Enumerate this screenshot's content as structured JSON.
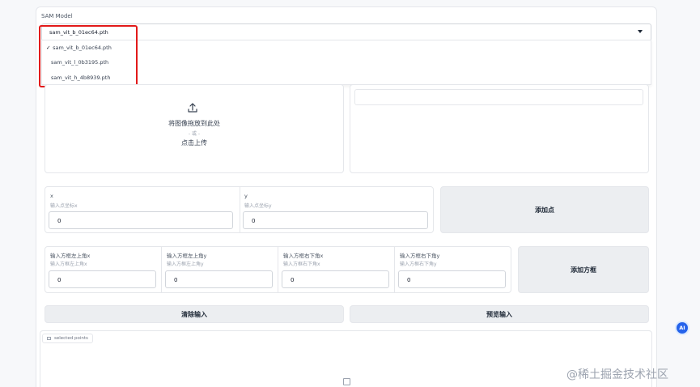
{
  "model": {
    "label": "SAM Model",
    "selected": "sam_vit_b_01ec64.pth",
    "options": [
      {
        "label": "sam_vit_b_01ec64.pth",
        "check": "✓"
      },
      {
        "label": "sam_vit_l_0b3195.pth",
        "check": ""
      },
      {
        "label": "sam_vit_h_4b8939.pth",
        "check": ""
      }
    ]
  },
  "upload": {
    "line1": "将图像拖放到此处",
    "line2": "- 或 -",
    "line3": "点击上传"
  },
  "point": {
    "x_label": "x",
    "x_hint": "输入点坐标x",
    "x_value": "0",
    "y_label": "y",
    "y_hint": "输入点坐标y",
    "y_value": "0",
    "add_button": "添加点"
  },
  "box": {
    "fields": [
      {
        "label": "输入方框左上角x",
        "hint": "输入方框左上角x",
        "value": "0"
      },
      {
        "label": "输入方框左上角y",
        "hint": "输入方框左上角y",
        "value": "0"
      },
      {
        "label": "输入方框右下角x",
        "hint": "输入方框右下角x",
        "value": "0"
      },
      {
        "label": "输入方框右下角y",
        "hint": "输入方框右下角y",
        "value": "0"
      }
    ],
    "add_button": "添加方框"
  },
  "actions": {
    "clear_button": "清除输入",
    "preview_button": "预览输入"
  },
  "selected_points": {
    "label": "selected points"
  },
  "badge": {
    "ai": "AI"
  },
  "watermark": "@稀土掘金技术社区",
  "colors": {
    "highlight": "#e21a1a",
    "button_bg": "#eceef1",
    "badge": "#2563eb"
  }
}
